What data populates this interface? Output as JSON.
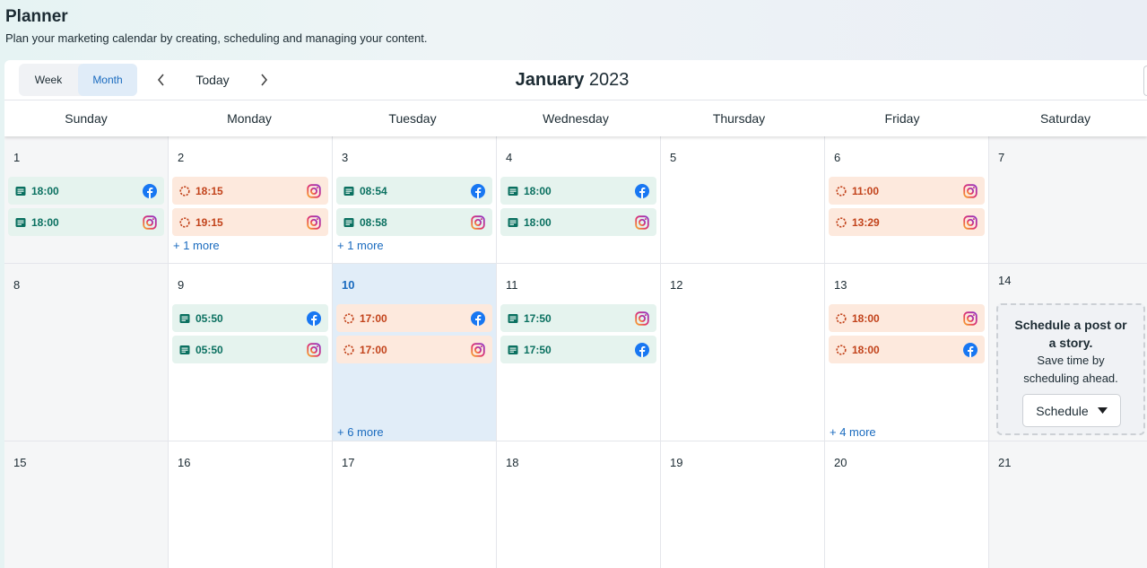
{
  "header": {
    "title": "Planner",
    "subtitle": "Plan your marketing calendar by creating, scheduling and managing your content."
  },
  "toolbar": {
    "week_label": "Week",
    "month_label": "Month",
    "active_view": "Month",
    "today_label": "Today",
    "month_name": "January",
    "year": "2023"
  },
  "weekdays": [
    "Sunday",
    "Monday",
    "Tuesday",
    "Wednesday",
    "Thursday",
    "Friday",
    "Saturday"
  ],
  "colors": {
    "published_bg": "#e5f3ee",
    "published_text": "#0a7060",
    "scheduled_bg": "#fde9dd",
    "scheduled_text": "#c2431b",
    "accent": "#1a6bbf",
    "today_bg": "#e1edf8"
  },
  "weeks": [
    [
      {
        "day": "1",
        "weekend": true,
        "posts": [
          {
            "time": "18:00",
            "status": "published",
            "network": "facebook"
          },
          {
            "time": "18:00",
            "status": "published",
            "network": "instagram"
          }
        ]
      },
      {
        "day": "2",
        "posts": [
          {
            "time": "18:15",
            "status": "scheduled",
            "network": "instagram"
          },
          {
            "time": "19:15",
            "status": "scheduled",
            "network": "instagram"
          }
        ],
        "more": "+ 1 more"
      },
      {
        "day": "3",
        "posts": [
          {
            "time": "08:54",
            "status": "published",
            "network": "facebook"
          },
          {
            "time": "08:58",
            "status": "published",
            "network": "instagram"
          }
        ],
        "more": "+ 1 more"
      },
      {
        "day": "4",
        "posts": [
          {
            "time": "18:00",
            "status": "published",
            "network": "facebook"
          },
          {
            "time": "18:00",
            "status": "published",
            "network": "instagram"
          }
        ]
      },
      {
        "day": "5",
        "posts": []
      },
      {
        "day": "6",
        "posts": [
          {
            "time": "11:00",
            "status": "scheduled",
            "network": "instagram"
          },
          {
            "time": "13:29",
            "status": "scheduled",
            "network": "instagram"
          }
        ]
      },
      {
        "day": "7",
        "weekend": true,
        "posts": []
      }
    ],
    [
      {
        "day": "8",
        "weekend": true,
        "posts": []
      },
      {
        "day": "9",
        "posts": [
          {
            "time": "05:50",
            "status": "published",
            "network": "facebook"
          },
          {
            "time": "05:50",
            "status": "published",
            "network": "instagram"
          }
        ]
      },
      {
        "day": "10",
        "today": true,
        "posts": [
          {
            "time": "17:00",
            "status": "scheduled",
            "network": "facebook"
          },
          {
            "time": "17:00",
            "status": "scheduled",
            "network": "instagram"
          }
        ],
        "more": "+ 6 more"
      },
      {
        "day": "11",
        "posts": [
          {
            "time": "17:50",
            "status": "published",
            "network": "instagram"
          },
          {
            "time": "17:50",
            "status": "published",
            "network": "facebook"
          }
        ]
      },
      {
        "day": "12",
        "posts": []
      },
      {
        "day": "13",
        "posts": [
          {
            "time": "18:00",
            "status": "scheduled",
            "network": "instagram"
          },
          {
            "time": "18:00",
            "status": "scheduled",
            "network": "facebook"
          }
        ],
        "more": "+ 4 more"
      },
      {
        "day": "14",
        "weekend": true,
        "posts": [],
        "promo": true
      }
    ],
    [
      {
        "day": "15",
        "weekend": true,
        "posts": []
      },
      {
        "day": "16",
        "posts": []
      },
      {
        "day": "17",
        "posts": []
      },
      {
        "day": "18",
        "posts": []
      },
      {
        "day": "19",
        "posts": []
      },
      {
        "day": "20",
        "posts": []
      },
      {
        "day": "21",
        "weekend": true,
        "posts": []
      }
    ]
  ],
  "promo": {
    "title": "Schedule a post or a story.",
    "text": "Save time by scheduling ahead.",
    "button_label": "Schedule"
  }
}
